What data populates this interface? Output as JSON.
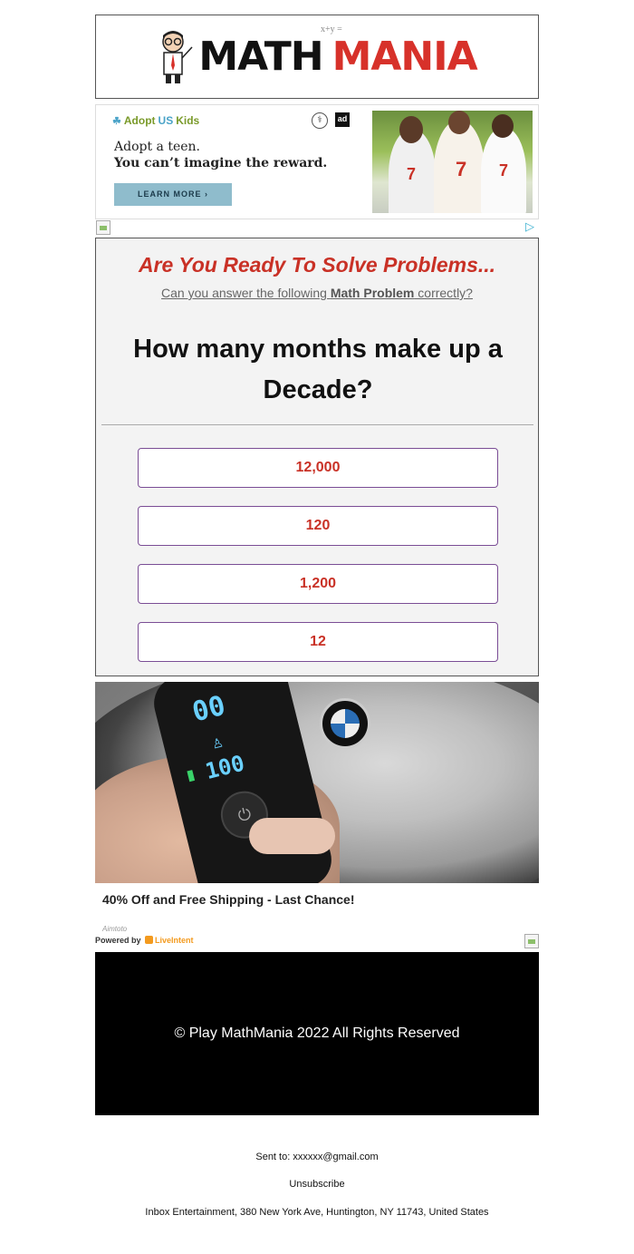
{
  "header": {
    "logo_word1": "MATH",
    "logo_word2": "MANIA",
    "formula": "x+y ="
  },
  "ad": {
    "brand_adopt": "Adopt",
    "brand_us": "US",
    "brand_kids": "Kids",
    "hhs_glyph": "⚕",
    "council": "ad",
    "line1": "Adopt a teen.",
    "line2": "You can’t imagine the reward.",
    "button": "LEARN MORE  ›",
    "adchoice_glyph": "▷"
  },
  "quiz": {
    "heading": "Are You Ready To Solve Problems...",
    "sub_prefix": "Can you answer the following ",
    "sub_bold": "Math Problem",
    "sub_suffix": " correctly?",
    "question": "How many months make up a Decade?",
    "answers": [
      "12,000",
      "120",
      "1,200",
      "12"
    ]
  },
  "product": {
    "digits_top": "00",
    "digits_bottom": "100",
    "caption": "40% Off and Free Shipping - Last Chance!"
  },
  "powered": {
    "aimtoto": "Aimtoto",
    "label": "Powered by ",
    "brand": "LiveIntent"
  },
  "footer": {
    "copyright": "© Play MathMania 2022 All Rights Reserved",
    "sent_to": "Sent to: xxxxxx@gmail.com",
    "unsubscribe": "Unsubscribe",
    "address": "Inbox Entertainment, 380 New York Ave, Huntington, NY 11743, United States"
  },
  "colors": {
    "accent_red": "#c93126",
    "answer_border": "#7a4d95",
    "liveintent_orange": "#f39a1e"
  }
}
